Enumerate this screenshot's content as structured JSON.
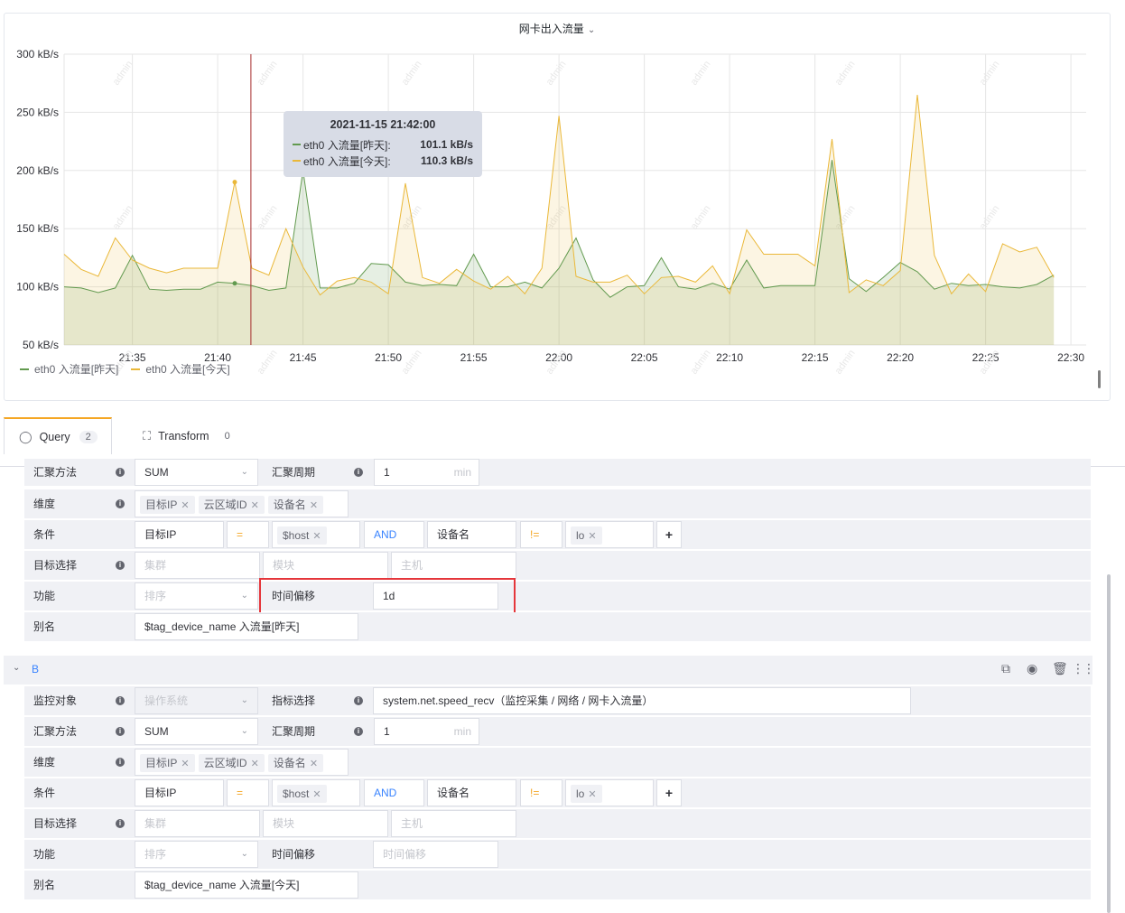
{
  "panel": {
    "title": "网卡出入流量",
    "tooltip": {
      "time": "2021-11-15 21:42:00",
      "rows": [
        {
          "name": "eth0 入流量[昨天]:",
          "value": "101.1 kB/s",
          "color": "#629a4f"
        },
        {
          "name": "eth0 入流量[今天]:",
          "value": "110.3 kB/s",
          "color": "#eab839"
        }
      ]
    },
    "legend": [
      {
        "name": "eth0 入流量[昨天]",
        "color": "#629a4f"
      },
      {
        "name": "eth0 入流量[今天]",
        "color": "#eab839"
      }
    ],
    "watermark": "admin"
  },
  "chart_data": {
    "type": "area",
    "ylim": [
      50,
      300
    ],
    "y_ticks": [
      "50 kB/s",
      "100 kB/s",
      "150 kB/s",
      "200 kB/s",
      "250 kB/s",
      "300 kB/s"
    ],
    "x_ticks": [
      "21:35",
      "21:40",
      "21:45",
      "21:50",
      "21:55",
      "22:00",
      "22:05",
      "22:10",
      "22:15",
      "22:20",
      "22:25",
      "22:30"
    ],
    "x_start": "21:31",
    "x_end": "22:26",
    "crosshair": "21:42",
    "series": [
      {
        "name": "eth0 入流量[昨天]",
        "color": "#629a4f",
        "values": [
          100,
          99,
          95,
          99,
          127,
          98,
          97,
          98,
          98,
          104,
          103,
          101,
          97,
          99,
          200,
          99,
          99,
          103,
          120,
          119,
          104,
          101,
          102,
          101,
          128,
          100,
          100,
          104,
          99,
          116,
          142,
          106,
          91,
          100,
          101,
          125,
          100,
          98,
          103,
          98,
          123,
          99,
          101,
          101,
          101,
          209,
          107,
          96,
          108,
          121,
          113,
          98,
          103,
          101,
          102,
          100,
          99,
          102,
          110
        ]
      },
      {
        "name": "eth0 入流量[今天]",
        "color": "#eab839",
        "values": [
          128,
          115,
          109,
          142,
          123,
          116,
          112,
          116,
          116,
          116,
          190,
          116,
          110,
          150,
          117,
          93,
          105,
          108,
          104,
          94,
          189,
          108,
          103,
          115,
          105,
          98,
          109,
          94,
          116,
          247,
          109,
          104,
          104,
          110,
          94,
          108,
          109,
          104,
          118,
          94,
          149,
          128,
          128,
          128,
          118,
          227,
          95,
          106,
          101,
          114,
          265,
          127,
          94,
          111,
          96,
          137,
          130,
          134,
          108
        ]
      }
    ]
  },
  "tabs": [
    {
      "label": "Query",
      "count": "2",
      "icon": "database-icon"
    },
    {
      "label": "Transform",
      "count": "0",
      "icon": "transform-icon"
    }
  ],
  "queryA": {
    "agg_label": "汇聚方法",
    "agg_value": "SUM",
    "period_label": "汇聚周期",
    "period_value": "1",
    "period_unit": "min",
    "dim_label": "维度",
    "dims": [
      "目标IP",
      "云区域ID",
      "设备名"
    ],
    "cond_label": "条件",
    "cond_field1": "目标IP",
    "cond_op1": "=",
    "cond_val1": "$host",
    "cond_and": "AND",
    "cond_field2": "设备名",
    "cond_op2": "!=",
    "cond_val2": "lo",
    "target_label": "目标选择",
    "target_ph1": "集群",
    "target_ph2": "模块",
    "target_ph3": "主机",
    "func_label": "功能",
    "func_ph": "排序",
    "offset_label": "时间偏移",
    "offset_value": "1d",
    "alias_label": "别名",
    "alias_value": "$tag_device_name 入流量[昨天]"
  },
  "queryB": {
    "name": "B",
    "mon_label": "监控对象",
    "mon_value": "操作系统",
    "metric_label": "指标选择",
    "metric_value": "system.net.speed_recv（监控采集 / 网络 / 网卡入流量）",
    "agg_label": "汇聚方法",
    "agg_value": "SUM",
    "period_label": "汇聚周期",
    "period_value": "1",
    "period_unit": "min",
    "dim_label": "维度",
    "dims": [
      "目标IP",
      "云区域ID",
      "设备名"
    ],
    "cond_label": "条件",
    "cond_field1": "目标IP",
    "cond_op1": "=",
    "cond_val1": "$host",
    "cond_and": "AND",
    "cond_field2": "设备名",
    "cond_op2": "!=",
    "cond_val2": "lo",
    "target_label": "目标选择",
    "target_ph1": "集群",
    "target_ph2": "模块",
    "target_ph3": "主机",
    "func_label": "功能",
    "func_ph": "排序",
    "offset_label": "时间偏移",
    "offset_ph": "时间偏移",
    "alias_label": "别名",
    "alias_value": "$tag_device_name 入流量[今天]"
  }
}
